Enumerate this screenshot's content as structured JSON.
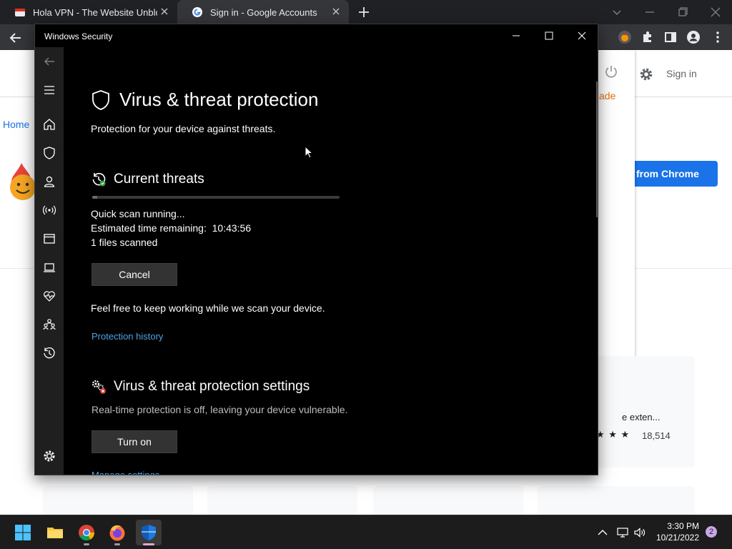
{
  "browser": {
    "tabs": [
      {
        "title": "Hola VPN - The Website Unblock",
        "active": false
      },
      {
        "title": "Sign in - Google Accounts",
        "active": true
      }
    ]
  },
  "webpage": {
    "home_link": "Home",
    "upgrade_text": "ade",
    "signin": "Sign in",
    "add_button": "from Chrome",
    "ext_card": {
      "name": "e exten...",
      "stars": "★ ★ ★",
      "count": "18,514"
    }
  },
  "window": {
    "title": "Windows Security"
  },
  "page": {
    "title": "Virus & threat protection",
    "subtitle": "Protection for your device against threats."
  },
  "current_threats": {
    "heading": "Current threats",
    "progress_fraction": 0.02,
    "status": "Quick scan running...",
    "time_remaining": "Estimated time remaining:  10:43:56",
    "files_scanned": "1 files scanned",
    "cancel_label": "Cancel",
    "working_note": "Feel free to keep working while we scan your device.",
    "history_link": "Protection history"
  },
  "settings": {
    "heading": "Virus & threat protection settings",
    "description": "Real-time protection is off, leaving your device vulnerable.",
    "turn_on_label": "Turn on",
    "manage_link": "Manage settings"
  },
  "taskbar": {
    "time": "3:30 PM",
    "date": "10/21/2022",
    "notifications": "2"
  },
  "colors": {
    "accent_link": "#4ca3e8",
    "chrome_blue": "#1a73e8"
  }
}
